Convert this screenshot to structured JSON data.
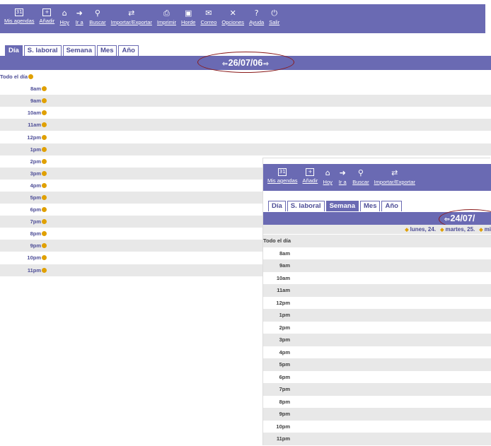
{
  "window1": {
    "toolbar": [
      {
        "label": "Mis agendas",
        "icon": "calendar-icon"
      },
      {
        "label": "Añadir",
        "icon": "add-event-icon"
      },
      {
        "label": "Hoy",
        "icon": "today-icon"
      },
      {
        "label": "Ir a",
        "icon": "goto-icon"
      },
      {
        "label": "Buscar",
        "icon": "search-icon"
      },
      {
        "label": "Importar/Exportar",
        "icon": "import-export-icon"
      },
      {
        "label": "Imprimir",
        "icon": "print-icon"
      },
      {
        "label": "Horde",
        "icon": "horde-icon"
      },
      {
        "label": "Correo",
        "icon": "mail-icon"
      },
      {
        "label": "Opciones",
        "icon": "options-icon"
      },
      {
        "label": "Ayuda",
        "icon": "help-icon"
      },
      {
        "label": "Salir",
        "icon": "logout-icon"
      }
    ],
    "tabs": [
      "Día",
      "S. laboral",
      "Semana",
      "Mes",
      "Año"
    ],
    "active_tab": "Día",
    "date": "26/07/06",
    "all_day_label": "Todo el día",
    "times": [
      "8am",
      "9am",
      "10am",
      "11am",
      "12pm",
      "1pm",
      "2pm",
      "3pm",
      "4pm",
      "5pm",
      "6pm",
      "7pm",
      "8pm",
      "9pm",
      "10pm",
      "11pm"
    ]
  },
  "window2": {
    "toolbar": [
      {
        "label": "Mis agendas",
        "icon": "calendar-icon"
      },
      {
        "label": "Añadir",
        "icon": "add-event-icon"
      },
      {
        "label": "Hoy",
        "icon": "today-icon"
      },
      {
        "label": "Ir a",
        "icon": "goto-icon"
      },
      {
        "label": "Buscar",
        "icon": "search-icon"
      },
      {
        "label": "Importar/Exportar",
        "icon": "import-export-icon"
      }
    ],
    "tabs": [
      "Día",
      "S. laboral",
      "Semana",
      "Mes",
      "Año"
    ],
    "active_tab": "Semana",
    "date": "24/07/",
    "days": [
      "lunes, 24.",
      "martes, 25.",
      "mi"
    ],
    "all_day_label": "Todo el día",
    "times": [
      "8am",
      "9am",
      "10am",
      "11am",
      "12pm",
      "1pm",
      "2pm",
      "3pm",
      "4pm",
      "5pm",
      "6pm",
      "7pm",
      "8pm",
      "9pm",
      "10pm",
      "11pm"
    ]
  },
  "colors": {
    "header": "#6a6ab3",
    "accent": "#e0a000",
    "annotation": "#8a1a1a",
    "row_alt": "#e8e8e8"
  }
}
